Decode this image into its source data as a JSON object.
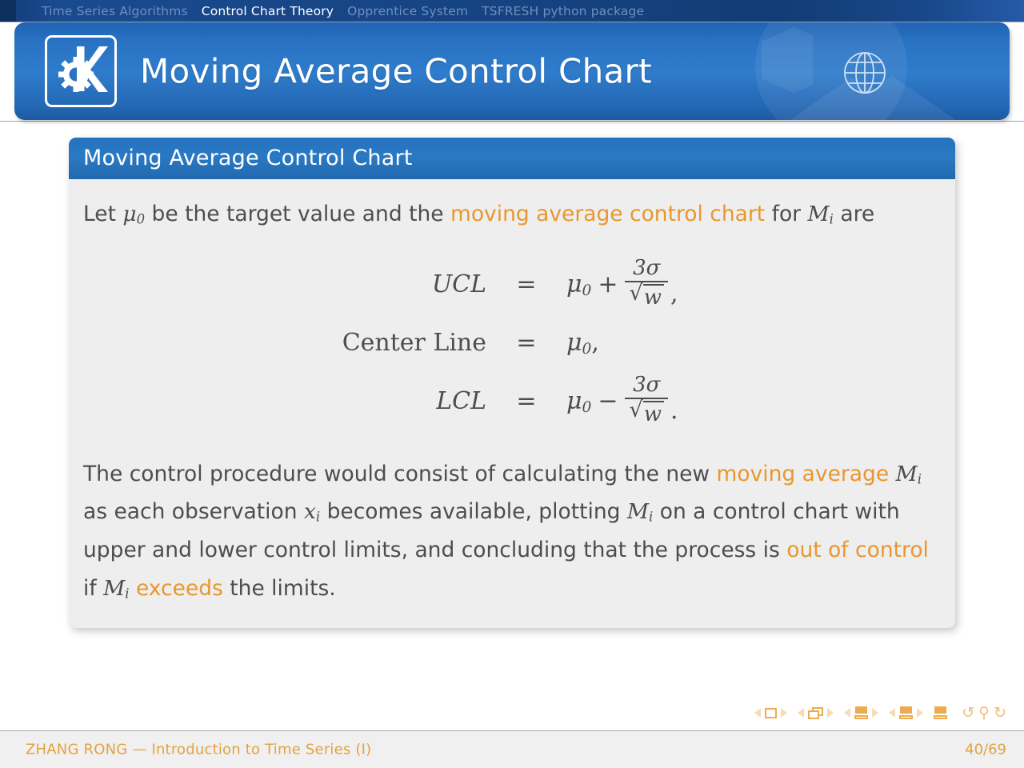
{
  "navbar": {
    "items": [
      {
        "label": "Time Series Algorithms",
        "active": false
      },
      {
        "label": "Control Chart Theory",
        "active": true
      },
      {
        "label": "Opprentice System",
        "active": false
      },
      {
        "label": "TSFRESH python package",
        "active": false
      }
    ]
  },
  "header": {
    "title": "Moving Average Control Chart",
    "logo_icon": "kde-gear-k-logo",
    "right_icon": "globe-icon"
  },
  "block": {
    "title": "Moving Average Control Chart",
    "paragraph1": {
      "part1": "Let ",
      "mu": "μ",
      "mu_sub": "0",
      "part2": " be the target value and the ",
      "highlight": "moving average control chart",
      "part3": " for ",
      "M": "M",
      "M_sub": "i",
      "part4": " are"
    },
    "equations": [
      {
        "lhs": "UCL",
        "lhs_style": "italic",
        "rel": "=",
        "mu": "μ",
        "mu_sub": "0",
        "op": "+",
        "frac_num": "3σ",
        "frac_den": "w",
        "punct": ","
      },
      {
        "lhs": "Center Line",
        "lhs_style": "upright",
        "rel": "=",
        "mu": "μ",
        "mu_sub": "0",
        "op": "",
        "frac_num": "",
        "frac_den": "",
        "punct": ","
      },
      {
        "lhs": "LCL",
        "lhs_style": "italic",
        "rel": "=",
        "mu": "μ",
        "mu_sub": "0",
        "op": "−",
        "frac_num": "3σ",
        "frac_den": "w",
        "punct": "."
      }
    ],
    "paragraph2": {
      "part1": "The control procedure would consist of calculating the new ",
      "highlight1": "moving average",
      "part2": " ",
      "M1": "M",
      "M1_sub": "i",
      "part3": " as each observation ",
      "x1": "x",
      "x1_sub": "i",
      "part4": " becomes available, plotting ",
      "M2": "M",
      "M2_sub": "i",
      "part5": " on a control chart with upper and lower control limits, and concluding that the process is ",
      "highlight2": "out of control",
      "part6": " if ",
      "M3": "M",
      "M3_sub": "i",
      "part7": " ",
      "highlight3": "exceeds",
      "part8": " the limits."
    }
  },
  "nav_symbols": {
    "icons": [
      "prev-frame-arrow",
      "frame-box",
      "next-frame-arrow",
      "prev-subsection-arrow",
      "subsection-stack",
      "next-subsection-arrow",
      "prev-section-arrow",
      "section-doc",
      "next-section-arrow",
      "prev-presentation-arrow",
      "presentation-doc",
      "next-presentation-arrow",
      "beginning-doc",
      "back-icon",
      "search-icon",
      "forward-icon"
    ]
  },
  "footer": {
    "author": "ZHANG RONG — Introduction to Time Series (I)",
    "page": "40/69"
  },
  "colors": {
    "header_blue": "#2a73c4",
    "navbar_blue": "#15427f",
    "block_title_blue": "#2572bd",
    "block_body_gray": "#eeeeee",
    "highlight_orange": "#e8972e",
    "footer_orange": "#e3a23f",
    "body_text_gray": "#4d4d4d"
  }
}
